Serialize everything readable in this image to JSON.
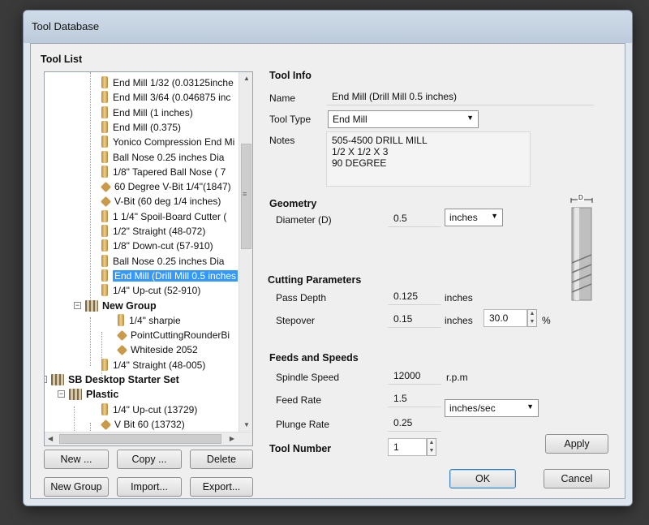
{
  "window": {
    "title": "Tool Database"
  },
  "tool_list": {
    "heading": "Tool List",
    "rows": [
      {
        "label": "End Mill 1/32 (0.03125inche",
        "icon": "endmill-icon"
      },
      {
        "label": "End Mill 3/64 (0.046875 inc",
        "icon": "endmill-icon"
      },
      {
        "label": "End Mill (1 inches)",
        "icon": "endmill-icon"
      },
      {
        "label": "End Mill (0.375)",
        "icon": "endmill-icon"
      },
      {
        "label": "Yonico Compression End Mi",
        "icon": "endmill-icon"
      },
      {
        "label": "Ball Nose 0.25 inches Dia",
        "icon": "ballnose-icon"
      },
      {
        "label": "1/8\" Tapered Ball Nose ( 7",
        "icon": "ballnose-icon"
      },
      {
        "label": "60 Degree V-Bit 1/4\"(1847)",
        "icon": "vbit-icon"
      },
      {
        "label": "V-Bit (60 deg 1/4 inches)",
        "icon": "vbit-icon"
      },
      {
        "label": "1 1/4\" Spoil-Board Cutter (",
        "icon": "endmill-icon"
      },
      {
        "label": "1/2\" Straight  (48-072)",
        "icon": "endmill-icon"
      },
      {
        "label": "1/8\"  Down-cut (57-910)",
        "icon": "endmill-icon"
      },
      {
        "label": "Ball Nose 0.25 inches Dia",
        "icon": "ballnose-icon"
      },
      {
        "label": "End Mill (Drill Mill 0.5 inches",
        "icon": "endmill-icon",
        "selected": true
      },
      {
        "label": "1/4\" Up-cut (52-910)",
        "icon": "endmill-icon"
      }
    ],
    "new_group": {
      "label": "New Group",
      "children": [
        "1/4\" sharpie",
        "PointCuttingRounderBi",
        "Whiteside 2052"
      ]
    },
    "straight": "1/4\" Straight  (48-005)",
    "starter_set": {
      "label": "SB Desktop Starter Set",
      "plastic": {
        "label": "Plastic",
        "children": [
          "1/4\" Up-cut (13729)",
          "V Bit 60 (13732)"
        ]
      }
    }
  },
  "buttons": {
    "new": "New ...",
    "copy": "Copy ...",
    "delete": "Delete",
    "new_group": "New Group",
    "import": "Import...",
    "export": "Export...",
    "apply": "Apply",
    "ok": "OK",
    "cancel": "Cancel"
  },
  "tool_info": {
    "heading": "Tool Info",
    "name_label": "Name",
    "name_value": "End Mill (Drill Mill 0.5 inches)",
    "type_label": "Tool Type",
    "type_value": "End Mill",
    "notes_label": "Notes",
    "notes_lines": [
      "505-4500 DRILL MILL",
      "1/2 X 1/2 X 3",
      "90 DEGREE"
    ]
  },
  "geometry": {
    "heading": "Geometry",
    "diameter_label": "Diameter (D)",
    "diameter_value": "0.5",
    "units": "inches",
    "diagram_label": "D"
  },
  "cutting": {
    "heading": "Cutting Parameters",
    "pass_depth_label": "Pass Depth",
    "pass_depth_value": "0.125",
    "pass_depth_units": "inches",
    "stepover_label": "Stepover",
    "stepover_value": "0.15",
    "stepover_units": "inches",
    "stepover_pct": "30.0",
    "pct_sign": "%"
  },
  "feeds": {
    "heading": "Feeds and Speeds",
    "spindle_label": "Spindle Speed",
    "spindle_value": "12000",
    "spindle_units": "r.p.m",
    "feed_label": "Feed Rate",
    "feed_value": "1.5",
    "plunge_label": "Plunge Rate",
    "plunge_value": "0.25",
    "rate_units": "inches/sec"
  },
  "tool_number": {
    "label": "Tool Number",
    "value": "1"
  }
}
